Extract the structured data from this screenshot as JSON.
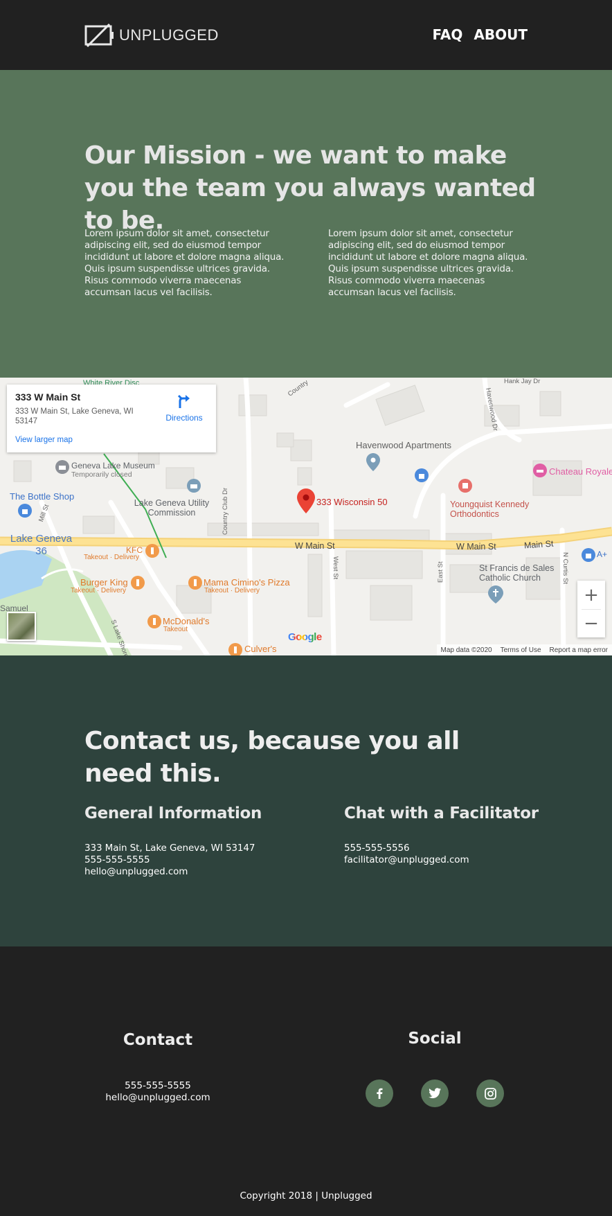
{
  "header": {
    "brand": "UNPLUGGED",
    "nav": [
      "FAQ",
      "ABOUT"
    ]
  },
  "mission": {
    "title": "Our Mission - we want to make you the team you always wanted to be.",
    "paragraph_left": "Lorem ipsum dolor sit amet, consectetur adipiscing elit, sed do eiusmod tempor incididunt ut labore et dolore magna aliqua. Quis ipsum suspendisse ultrices gravida. Risus commodo viverra maecenas accumsan lacus vel facilisis.",
    "paragraph_right": "Lorem ipsum dolor sit amet, consectetur adipiscing elit, sed do eiusmod tempor incididunt ut labore et dolore magna aliqua. Quis ipsum suspendisse ultrices gravida. Risus commodo viverra maecenas accumsan lacus vel facilisis."
  },
  "map": {
    "card_title": "333 W Main St",
    "card_address": "333 W Main St, Lake Geneva, WI 53147",
    "card_link": "View larger map",
    "directions": "Directions",
    "marker_label": "333 Wisconsin 50",
    "places": {
      "white_river": "White River Disc",
      "havenwood": "Havenwood Apartments",
      "chateau": "Chateau Royale",
      "museum": "Geneva Lake Museum",
      "museum_note": "Temporarily closed",
      "bottle_shop": "The Bottle Shop",
      "utility": "Lake Geneva Utility Commission",
      "youngquist": "Youngquist Kennedy Orthodontics",
      "lake_geneva_36": "Lake Geneva 36",
      "kfc": "KFC",
      "kfc_note": "Takeout · Delivery",
      "burger_king": "Burger King",
      "burger_king_note": "Takeout · Delivery",
      "mama_cimino": "Mama Cimino's Pizza",
      "mama_cimino_note": "Takeout · Delivery",
      "mcdonalds": "McDonald's",
      "mcdonalds_note": "Takeout",
      "culvers": "Culver's",
      "st_francis": "St Francis de Sales Catholic Church",
      "a_plus": "A+",
      "samuel": "Samuel"
    },
    "streets": {
      "w_main_1": "W Main St",
      "w_main_2": "W Main St",
      "main": "Main St",
      "country": "Country Club Dr",
      "country_top": "Country",
      "west": "West St",
      "east": "East St",
      "n_curtis": "N Curtis St",
      "havenwood_dr": "Havenwood Dr",
      "hank_jay": "Hank Jay Dr",
      "mill": "Mill St",
      "s_lake_shore": "S Lake Shore"
    },
    "zoom_in": "+",
    "zoom_out": "−",
    "google": "Google",
    "attribution": [
      "Map data ©2020",
      "Terms of Use",
      "Report a map error"
    ]
  },
  "contact": {
    "title": "Contact us, because you all need this.",
    "general": {
      "heading": "General Information",
      "lines": [
        "333 Main St, Lake Geneva, WI 53147",
        "555-555-5555",
        "hello@unplugged.com"
      ]
    },
    "facilitator": {
      "heading": "Chat with a Facilitator",
      "lines": [
        "555-555-5556",
        "facilitator@unplugged.com"
      ]
    }
  },
  "footer": {
    "contact_heading": "Contact",
    "contact_lines": [
      "555-555-5555",
      "hello@unplugged.com"
    ],
    "social_heading": "Social",
    "social_icons": [
      "facebook-icon",
      "twitter-icon",
      "instagram-icon"
    ],
    "copyright": "Copyright 2018 | Unplugged"
  },
  "colors": {
    "header_bg": "#212121",
    "mission_bg": "#58755a",
    "contact_bg": "#2e433d",
    "social_circle": "#58755a"
  }
}
